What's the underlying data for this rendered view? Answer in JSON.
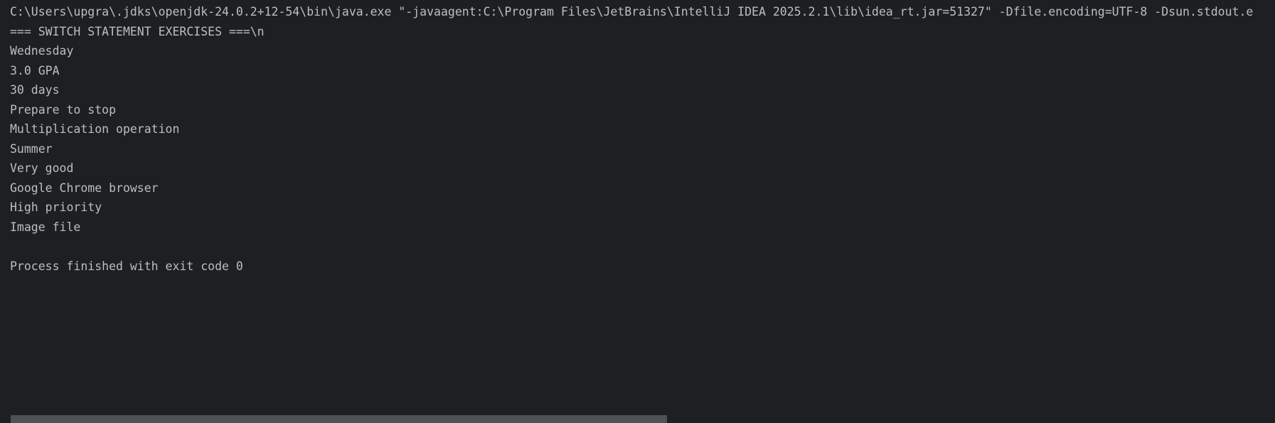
{
  "console": {
    "command_line": "C:\\Users\\upgra\\.jdks\\openjdk-24.0.2+12-54\\bin\\java.exe \"-javaagent:C:\\Program Files\\JetBrains\\IntelliJ IDEA 2025.2.1\\lib\\idea_rt.jar=51327\" -Dfile.encoding=UTF-8 -Dsun.stdout.e",
    "lines": [
      "=== SWITCH STATEMENT EXERCISES ===\\n",
      "Wednesday",
      "3.0 GPA",
      "30 days",
      "Prepare to stop",
      "Multiplication operation",
      "Summer",
      "Very good",
      "Google Chrome browser",
      "High priority",
      "Image file",
      "",
      "Process finished with exit code 0"
    ]
  }
}
